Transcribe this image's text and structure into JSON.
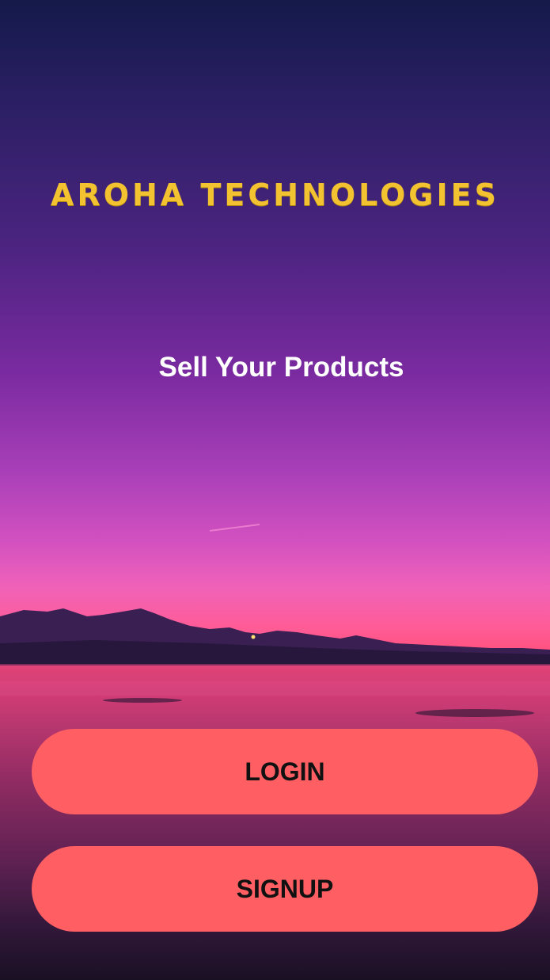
{
  "app": {
    "brand_title": "AROHA TECHNOLOGIES",
    "tagline": "Sell Your Products"
  },
  "actions": {
    "login_label": "LOGIN",
    "signup_label": "SIGNUP"
  },
  "colors": {
    "brand_text": "#f2c230",
    "tagline_text": "#ffffff",
    "button_bg": "#ff5e63",
    "button_text": "#111111"
  }
}
